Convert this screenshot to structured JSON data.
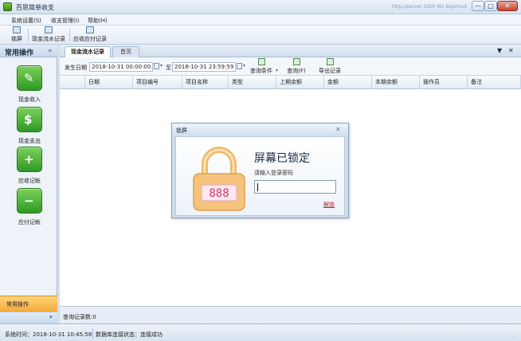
{
  "window": {
    "title": "百思简单收支",
    "extra": "http://server:1000 NU Baymout",
    "min_glyph": "—",
    "max_glyph": "□",
    "close_glyph": "✕"
  },
  "menu": [
    "系统设置(S)",
    "收支管理(I)",
    "帮助(H)"
  ],
  "toolbar": {
    "lock_label": "锁屏",
    "cash_flow_label": "现金流水记录",
    "receivable_payable_label": "应收应付记录"
  },
  "sidebar": {
    "title": "常用操作",
    "collapse_glyph": "«",
    "items": [
      {
        "label": "现金收入",
        "icon": "cash-income-icon",
        "glyph": "✎"
      },
      {
        "label": "现金支出",
        "icon": "cash-expense-icon",
        "glyph": "$"
      },
      {
        "label": "应收记帐",
        "icon": "receivable-icon",
        "glyph": "+"
      },
      {
        "label": "应付记帐",
        "icon": "payable-icon",
        "glyph": "−"
      }
    ],
    "bottom_label": "常用操作",
    "footer_glyph": "▾"
  },
  "tabs": {
    "items": [
      "现金流水记录",
      "首页"
    ],
    "pin_glyph": "▼",
    "close_glyph": "✕"
  },
  "filter": {
    "start_label": "发生日期",
    "start_value": "2018-10-31 00:00:00",
    "to_label": "至",
    "end_value": "2018-10-31 23:59:59",
    "dropdown_glyph": "▾",
    "query_conditions_label": "查询条件",
    "query_label": "查询(F)",
    "export_label": "导出记录"
  },
  "grid": {
    "columns": [
      "日期",
      "项目编号",
      "项目名称",
      "类型",
      "上期余额",
      "金额",
      "本期余额",
      "操作员",
      "备注"
    ]
  },
  "summary": "查询记录数:0",
  "status": {
    "system_time": "系统时间：2018-10-31 10:45:58",
    "db_status": "数据库连接状态：连接成功",
    "grip": "⋰"
  },
  "dialog": {
    "title": "锁屏",
    "close_glyph": "✕",
    "heading": "屏幕已锁定",
    "prompt": "请输入登录密码",
    "password_value": "",
    "unlock_label": "解锁",
    "lock_digits": "888"
  },
  "colors": {
    "accent": "#2f9a24",
    "sidebar_bottom": "#f5a93a",
    "lock_orange": "#f0b867",
    "lock_digits": "#d23a6a"
  }
}
